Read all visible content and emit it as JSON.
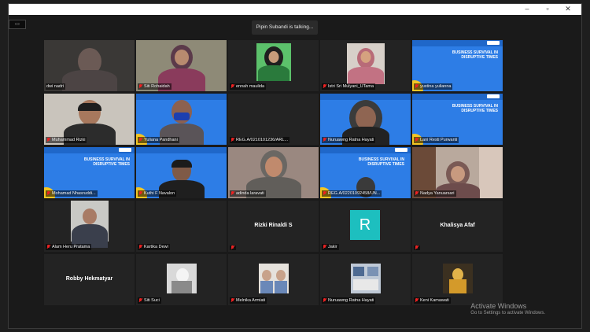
{
  "window": {
    "minimize_icon": "minimize-icon",
    "maximize_icon": "maximize-icon",
    "close_icon": "close-icon"
  },
  "speaker_banner": "Pipin Subandi is talking...",
  "banner_text": "BUSINESS SURVIVAL IN DISRUPTIVE TIMES",
  "participants": [
    {
      "name": "dwi nadri",
      "muted": false
    },
    {
      "name": "Siti Rohaidah",
      "muted": true
    },
    {
      "name": "ennah maulida",
      "muted": true
    },
    {
      "name": "Istri Sri Mulyani_UTama",
      "muted": true
    },
    {
      "name": "yustina yulianna",
      "muted": true
    },
    {
      "name": "Muhammad Rizki",
      "muted": true
    },
    {
      "name": "Yuliana Pandhani",
      "muted": true
    },
    {
      "name": "REG.A/0210101236/ARL...",
      "muted": true
    },
    {
      "name": "Nuruawng Ratna Hayati",
      "muted": true
    },
    {
      "name": "Lani Resti Purwanti",
      "muted": true
    },
    {
      "name": "Mohamad Nhasruddi...",
      "muted": true
    },
    {
      "name": "Kuthi F Navalon",
      "muted": true
    },
    {
      "name": "adinda laravati",
      "muted": true
    },
    {
      "name": "REG.A/02201092458/UN...",
      "muted": true
    },
    {
      "name": "Nadya Yanuarsari",
      "muted": true
    },
    {
      "name": "Alam Heru Pratama",
      "muted": true
    },
    {
      "name": "Kartika Dewi",
      "muted": true
    },
    {
      "name": "Rizki Rinaldi S",
      "muted": false
    },
    {
      "name": "Jakir",
      "muted": true
    },
    {
      "name": "Khalisya Afaf",
      "muted": false
    },
    {
      "name": "Robby Hekmatyar",
      "muted": false
    },
    {
      "name": "Siti Suci",
      "muted": true
    },
    {
      "name": "Melnika Armiati",
      "muted": true
    },
    {
      "name": "Nuruawng Ratna Hayati",
      "muted": true
    },
    {
      "name": "Keni Kamawati",
      "muted": true
    }
  ],
  "avatar_letter": "R",
  "watermark": {
    "title": "Activate Windows",
    "subtitle": "Go to Settings to activate Windows."
  },
  "colors": {
    "accent": "#2d7de6",
    "avatar": "#1dbfbf",
    "muted": "#e22222"
  }
}
